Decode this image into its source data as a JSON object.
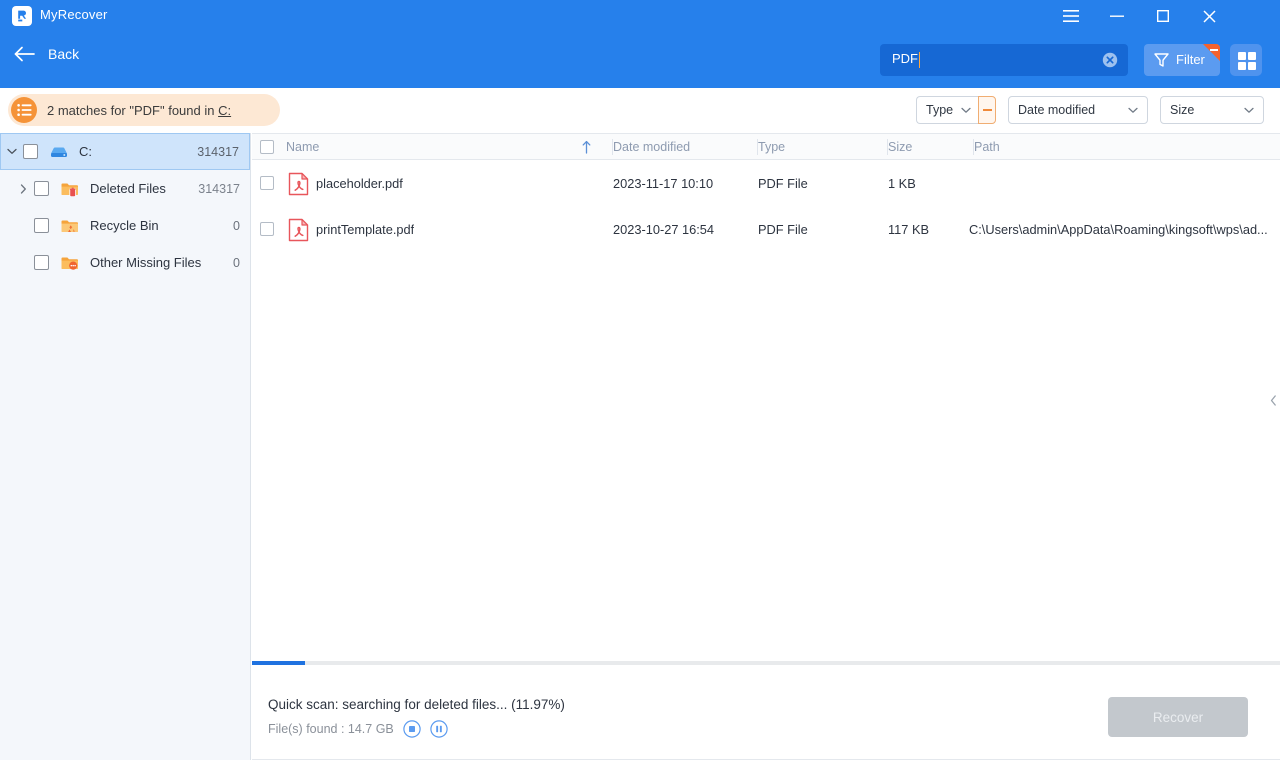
{
  "window": {
    "app_title": "MyRecover",
    "logo_icon": "myrecover-logo-icon",
    "menu_icon": "hamburger-menu-icon",
    "minimize_icon": "minimize-icon",
    "maximize_icon": "maximize-icon",
    "close_icon": "close-icon"
  },
  "toolbar": {
    "back_label": "Back",
    "back_icon": "arrow-left-icon",
    "search_value": "PDF",
    "search_clear_icon": "clear-circle-icon",
    "filter_label": "Filter",
    "filter_icon": "funnel-icon",
    "filter_badge": "-",
    "grid_view_icon": "grid-view-icon"
  },
  "banner": {
    "icon": "list-lines-icon",
    "prefix": "2 matches for \"PDF\"  found in ",
    "link": "C:"
  },
  "filters": [
    {
      "label": "Type",
      "chevron": "chevron-down-icon",
      "removable": true,
      "remove_icon": "minus-icon"
    },
    {
      "label": "Date modified",
      "chevron": "chevron-down-icon",
      "removable": false
    },
    {
      "label": "Size",
      "chevron": "chevron-down-icon",
      "removable": false
    }
  ],
  "sidebar": {
    "items": [
      {
        "label": "C:",
        "count": "314317",
        "icon": "hard-drive-icon",
        "selected": true,
        "expanded": true,
        "level": 0,
        "has_caret": true
      },
      {
        "label": "Deleted Files",
        "count": "314317",
        "icon": "folder-deleted-icon",
        "selected": false,
        "expanded": false,
        "level": 1,
        "has_caret": true
      },
      {
        "label": "Recycle Bin",
        "count": "0",
        "icon": "recycle-bin-icon",
        "selected": false,
        "expanded": false,
        "level": 1,
        "has_caret": false
      },
      {
        "label": "Other Missing Files",
        "count": "0",
        "icon": "folder-other-icon",
        "selected": false,
        "expanded": false,
        "level": 1,
        "has_caret": false
      }
    ]
  },
  "table": {
    "columns": {
      "name": "Name",
      "date_modified": "Date modified",
      "type": "Type",
      "size": "Size",
      "path": "Path"
    },
    "sort_icon": "sort-ascending-arrow-icon",
    "rows": [
      {
        "name": "placeholder.pdf",
        "date_modified": "2023-11-17 10:10",
        "type": "PDF File",
        "size": "1 KB",
        "path": "",
        "icon": "pdf-file-icon"
      },
      {
        "name": "printTemplate.pdf",
        "date_modified": "2023-10-27 16:54",
        "type": "PDF File",
        "size": "117 KB",
        "path": "C:\\Users\\admin\\AppData\\Roaming\\kingsoft\\wps\\ad...",
        "icon": "pdf-file-icon"
      }
    ]
  },
  "panel": {
    "collapse_icon": "chevron-left-icon"
  },
  "status": {
    "progress_percent": 11.97,
    "progress_bar_fill_percent": 5.2,
    "scan_text": "Quick scan: searching for deleted files... (11.97%)",
    "found_text": "File(s) found : 14.7 GB",
    "stop_icon": "stop-circle-icon",
    "pause_icon": "pause-circle-icon",
    "recover_label": "Recover"
  },
  "colors": {
    "header_blue": "#2680eb",
    "search_blue": "#1668d4",
    "filter_blue": "#5b9bf0",
    "badge_orange": "#f4622d",
    "banner_bg": "#fde8d4",
    "banner_icon": "#f59338",
    "selected_row": "#cfe4fb",
    "sidebar_bg": "#f4f7fb",
    "progress_blue": "#1f72e0",
    "pdf_red": "#e8565b",
    "recover_disabled": "#c3c8cd"
  }
}
